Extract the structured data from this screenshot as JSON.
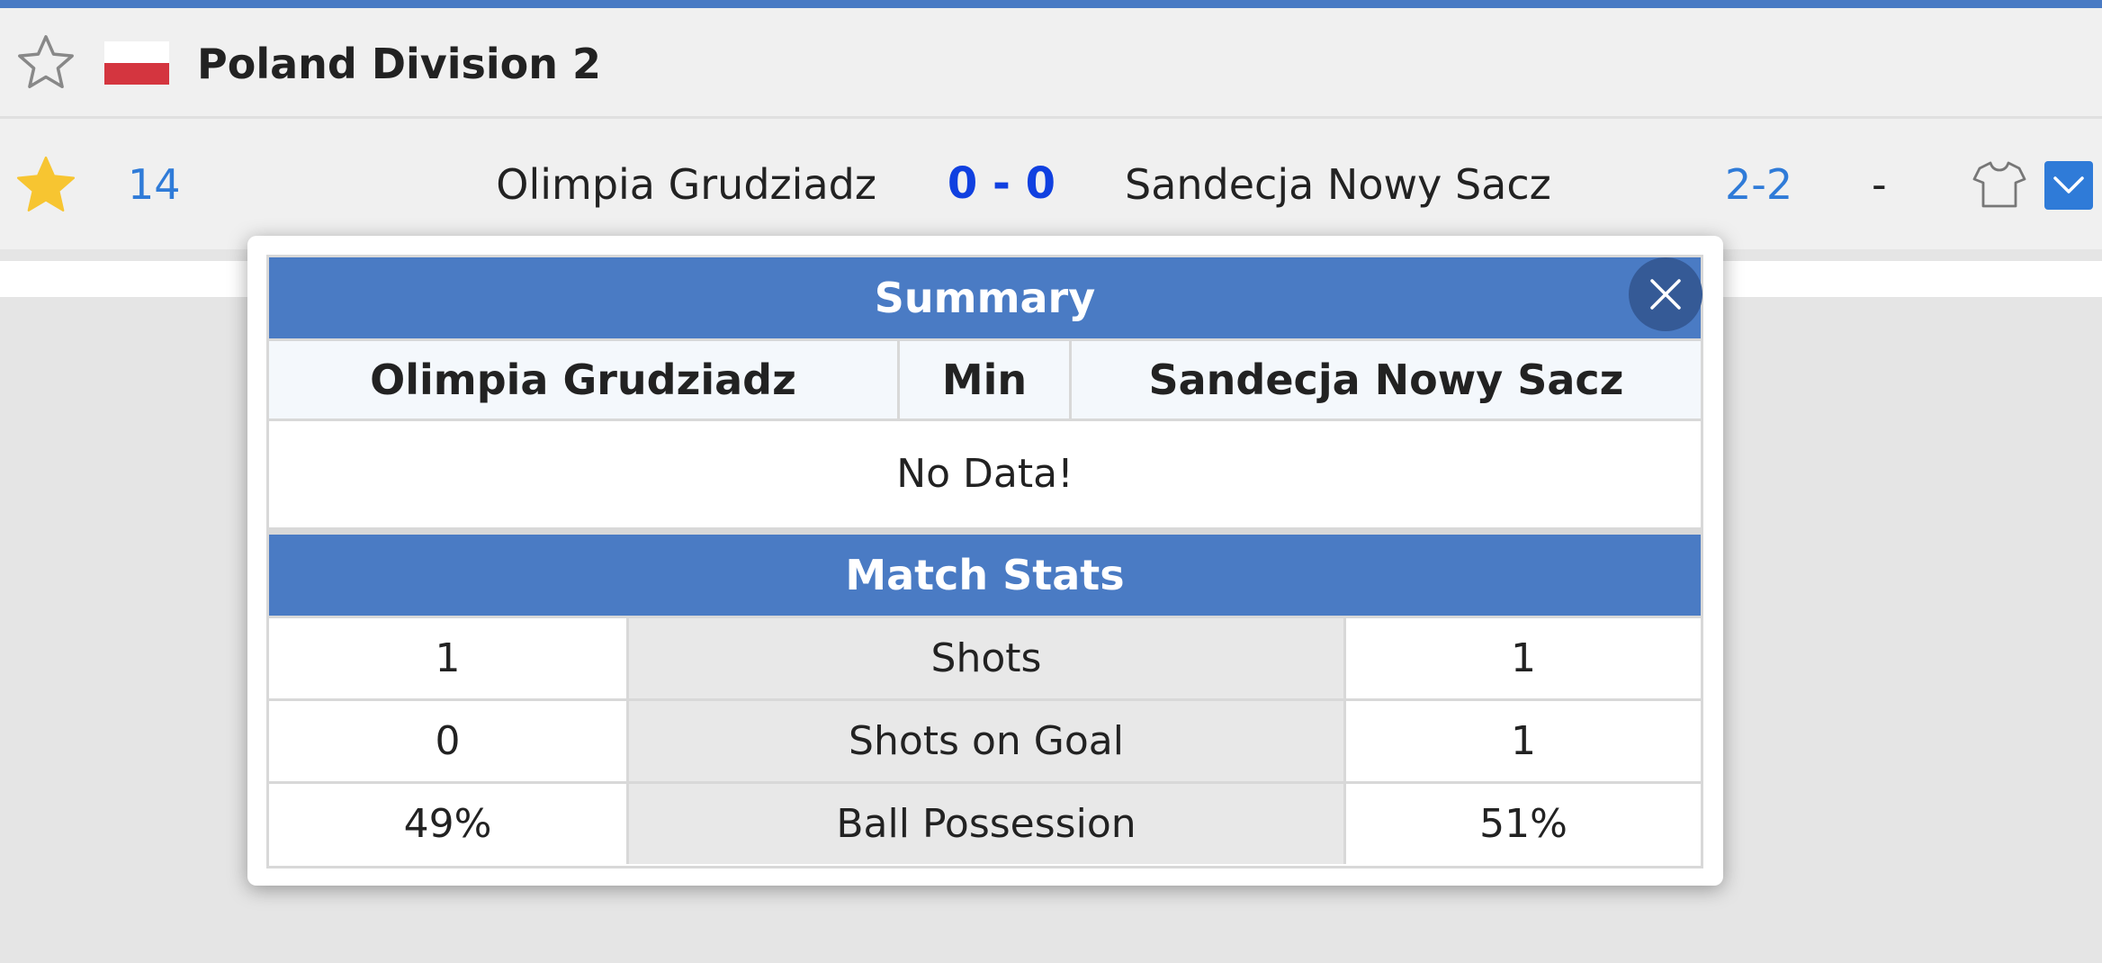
{
  "league": {
    "name": "Poland Division 2",
    "flag_colors": [
      "#ffffff",
      "#d4353f"
    ]
  },
  "match": {
    "minute": "14",
    "home_team": "Olimpia Grudziadz",
    "score": "0 - 0",
    "away_team": "Sandecja Nowy Sacz",
    "half_time_score": "2-2",
    "extra": "-",
    "favorited": true
  },
  "popup": {
    "summary_title": "Summary",
    "summary_columns": {
      "home": "Olimpia Grudziadz",
      "min": "Min",
      "away": "Sandecja Nowy Sacz"
    },
    "no_data": "No Data!",
    "stats_title": "Match Stats",
    "stats": [
      {
        "home": "1",
        "label": "Shots",
        "away": "1"
      },
      {
        "home": "0",
        "label": "Shots on Goal",
        "away": "1"
      },
      {
        "home": "49%",
        "label": "Ball Possession",
        "away": "51%"
      }
    ]
  },
  "colors": {
    "accent": "#4a7bc4",
    "link_blue": "#2f7bd8",
    "score_blue": "#1040e0",
    "star_gold": "#f7c531"
  },
  "icons": {
    "league_star": "star-outline-icon",
    "match_star": "star-filled-icon",
    "shirt": "shirt-icon",
    "expand": "chevron-down-icon",
    "close": "close-icon"
  }
}
